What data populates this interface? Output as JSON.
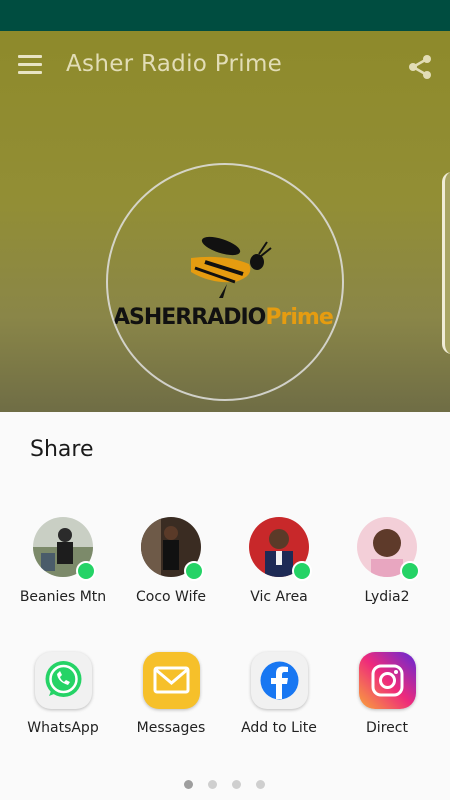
{
  "app": {
    "title": "Asher Radio Prime"
  },
  "hero": {
    "logo_text_main": "ASHERRADIO",
    "logo_text_accent": "Prime"
  },
  "share_sheet": {
    "title": "Share",
    "contacts": [
      {
        "name": "Beanies Mtn"
      },
      {
        "name": "Coco Wife"
      },
      {
        "name": "Vic Area"
      },
      {
        "name": "Lydia2"
      }
    ],
    "apps": [
      {
        "label": "WhatsApp",
        "icon": "whatsapp-icon"
      },
      {
        "label": "Messages",
        "icon": "messages-icon"
      },
      {
        "label": "Add to Lite",
        "icon": "facebook-lite-icon"
      },
      {
        "label": "Direct",
        "icon": "instagram-icon"
      }
    ],
    "pages": {
      "count": 4,
      "active": 1
    }
  },
  "colors": {
    "status_bar": "#004d40",
    "hero": "#928e35",
    "logo_accent": "#e59c10",
    "whatsapp": "#25d366"
  }
}
